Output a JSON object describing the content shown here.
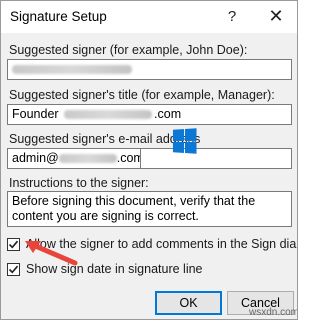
{
  "dialog": {
    "title": "Signature Setup",
    "help_glyph": "?",
    "close_glyph": "✕"
  },
  "fields": {
    "signer_label": "Suggested signer (for example, John Doe):",
    "signer_value": "",
    "title_label": "Suggested signer's title (for example, Manager):",
    "title_prefix": "Founder",
    "title_suffix": ".com",
    "email_label": "Suggested signer's e-mail address",
    "email_prefix": "admin@",
    "email_suffix": ".com",
    "instructions_label": "Instructions to the signer:",
    "instructions_value": "Before signing this document, verify that the content you are signing is correct."
  },
  "checkboxes": {
    "allow_comments_label": "Allow the signer to add comments in the Sign dialog",
    "allow_comments_checked": true,
    "show_date_label": "Show sign date in signature line",
    "show_date_checked": true
  },
  "buttons": {
    "ok_label": "OK",
    "cancel_label": "Cancel"
  },
  "watermark": "wsxdn.com",
  "colors": {
    "accent": "#0078d7",
    "arrow": "#e8443a"
  }
}
